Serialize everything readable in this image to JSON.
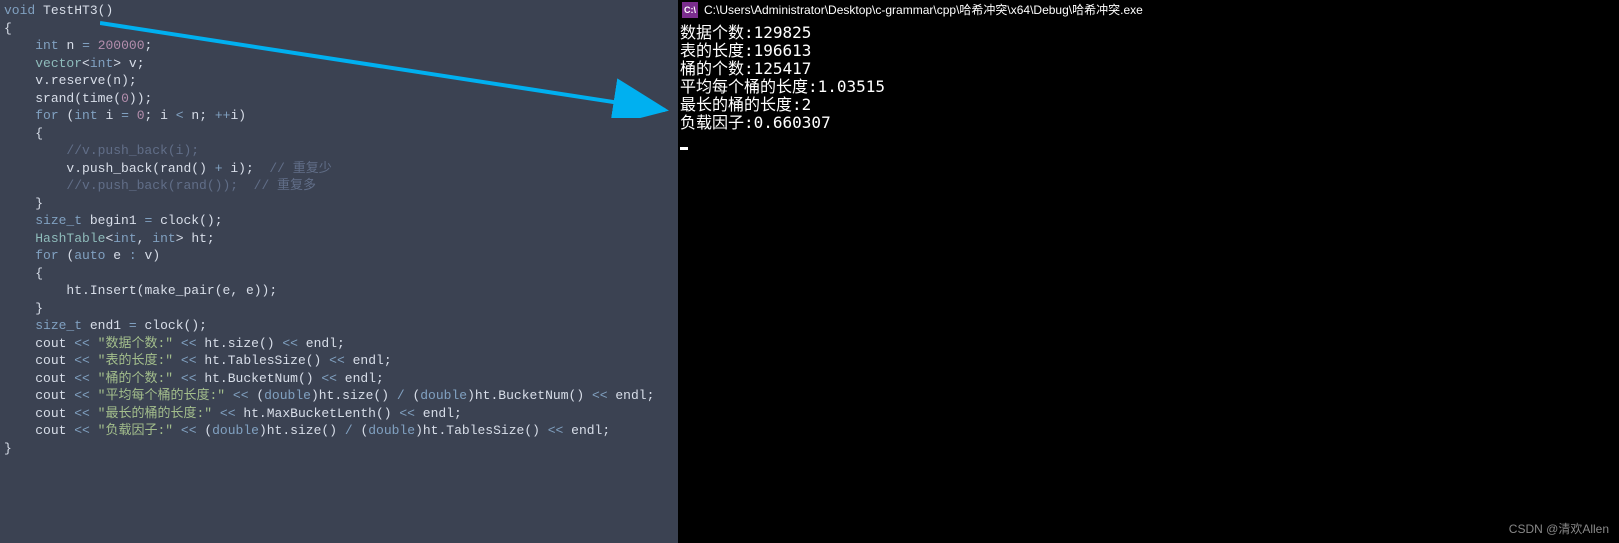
{
  "code": {
    "fn_decl_void": "void",
    "fn_name": "TestHT3",
    "int_kw": "int",
    "n_var": "n",
    "n_val": "200000",
    "vector_t": "vector",
    "int_t": "int",
    "v_var": "v",
    "reserve": "reserve",
    "srand": "srand",
    "time": "time",
    "zero": "0",
    "for_kw": "for",
    "i_var": "i",
    "lt": "<",
    "inc": "++",
    "comment1": "//v.push_back(i);",
    "push_back": "push_back",
    "rand": "rand",
    "comment2": "// 重复少",
    "comment3": "//v.push_back(rand());  // 重复多",
    "size_t": "size_t",
    "begin1": "begin1",
    "clock": "clock",
    "hashtable": "HashTable",
    "ht": "ht",
    "auto_kw": "auto",
    "e_var": "e",
    "colon": ":",
    "insert": "Insert",
    "make_pair": "make_pair",
    "end1": "end1",
    "cout": "cout",
    "endl": "endl",
    "str1": "\"数据个数:\"",
    "size": "size",
    "str2": "\"表的长度:\"",
    "tablessize": "TablesSize",
    "str3": "\"桶的个数:\"",
    "bucketnum": "BucketNum",
    "str4": "\"平均每个桶的长度:\"",
    "double_t": "double",
    "str5": "\"最长的桶的长度:\"",
    "maxbucket": "MaxBucketLenth",
    "str6": "\"负载因子:\""
  },
  "console": {
    "title": "C:\\Users\\Administrator\\Desktop\\c-grammar\\cpp\\哈希冲突\\x64\\Debug\\哈希冲突.exe",
    "icon_text": "C:\\",
    "line1": "数据个数:129825",
    "line2": "表的长度:196613",
    "line3": "桶的个数:125417",
    "line4": "平均每个桶的长度:1.03515",
    "line5": "最长的桶的长度:2",
    "line6": "负载因子:0.660307"
  },
  "watermark": "CSDN @清欢Allen"
}
